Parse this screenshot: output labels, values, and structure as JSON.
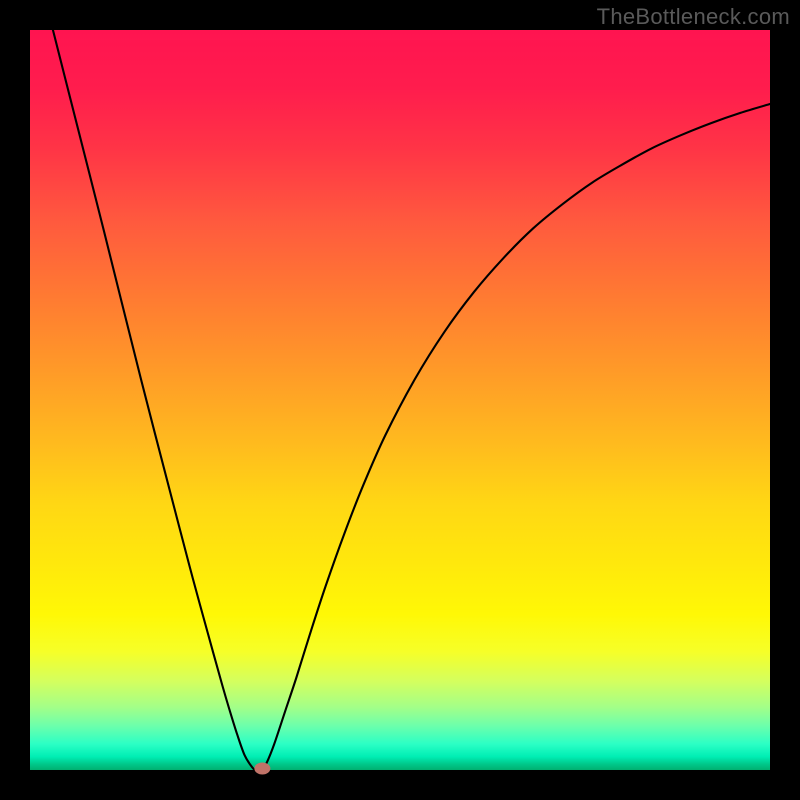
{
  "watermark": "TheBottleneck.com",
  "chart_data": {
    "type": "line",
    "title": "",
    "xlabel": "",
    "ylabel": "",
    "xlim": [
      0,
      100
    ],
    "ylim": [
      0,
      100
    ],
    "series": [
      {
        "name": "curve",
        "x": [
          3.1,
          5,
          10,
          15,
          20,
          22,
          24,
          26,
          27,
          28,
          29,
          30,
          30.5,
          31.5,
          32,
          33,
          34.5,
          36,
          38,
          40,
          42.5,
          45,
          48,
          52,
          56,
          60,
          64,
          68,
          72,
          76,
          80,
          84,
          88,
          92,
          96,
          100
        ],
        "values": [
          100,
          92.5,
          72.8,
          52.8,
          33.5,
          25.9,
          18.6,
          11.4,
          8.0,
          4.8,
          2.0,
          0.4,
          0.05,
          0.25,
          1.0,
          3.5,
          8.0,
          12.5,
          18.9,
          25.0,
          32.0,
          38.4,
          45.2,
          52.8,
          59.2,
          64.6,
          69.2,
          73.2,
          76.5,
          79.4,
          81.8,
          84.0,
          85.8,
          87.4,
          88.8,
          90.0
        ]
      }
    ],
    "marker": {
      "x": 31.4,
      "y": 0.2,
      "color": "#c07368"
    },
    "gradient_stops": [
      {
        "pos": 0,
        "color": "#ff1450"
      },
      {
        "pos": 50,
        "color": "#ffbb1e"
      },
      {
        "pos": 80,
        "color": "#fff806"
      },
      {
        "pos": 100,
        "color": "#00b070"
      }
    ]
  }
}
